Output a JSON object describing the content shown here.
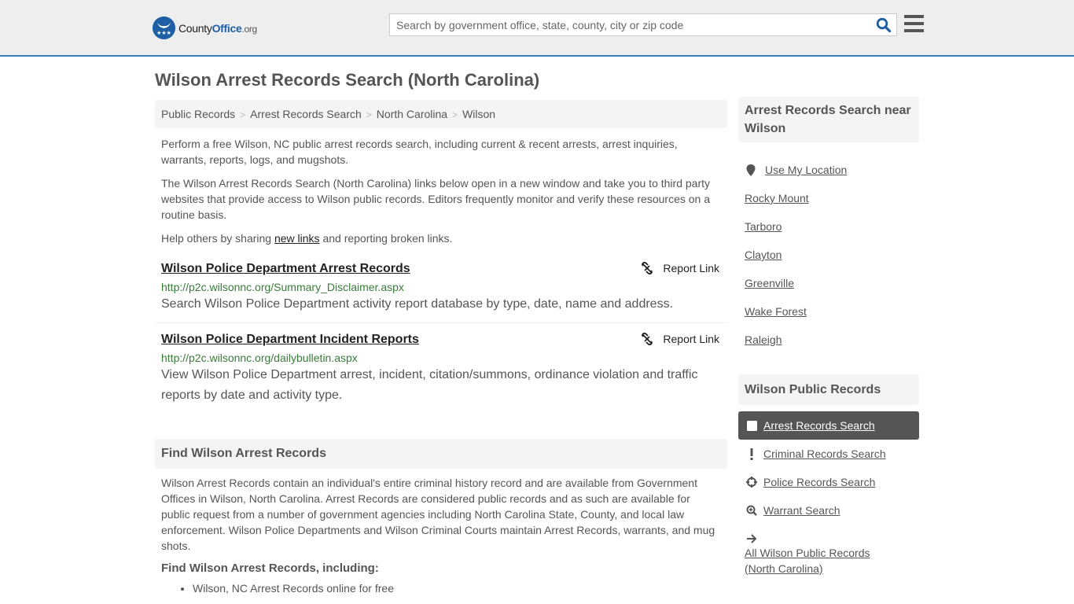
{
  "header": {
    "logo": {
      "name_part1": "County",
      "name_part2": "Office",
      "tld": ".org"
    },
    "search": {
      "placeholder": "Search by government office, state, county, city or zip code",
      "value": ""
    },
    "icons": {
      "search": "search-icon",
      "menu": "hamburger-menu-icon"
    }
  },
  "page": {
    "title": "Wilson Arrest Records Search (North Carolina)",
    "breadcrumb": [
      "Public Records",
      "Arrest Records Search",
      "North Carolina",
      "Wilson"
    ],
    "breadcrumb_separator": ">",
    "intro": {
      "p1": "Perform a free Wilson, NC public arrest records search, including current & recent arrests, arrest inquiries, warrants, reports, logs, and mugshots.",
      "p2": "The Wilson Arrest Records Search (North Carolina) links below open in a new window and take you to third party websites that provide access to Wilson public records. Editors frequently monitor and verify these resources on a routine basis.",
      "p3_before": "Help others by sharing ",
      "p3_link": "new links",
      "p3_after": " and reporting broken links."
    },
    "links": [
      {
        "title": "Wilson Police Department Arrest Records",
        "url": "http://p2c.wilsonnc.org/Summary_Disclaimer.aspx",
        "description": "Search Wilson Police Department activity report database by type, date, name and address.",
        "report_label": "Report Link"
      },
      {
        "title": "Wilson Police Department Incident Reports",
        "url": "http://p2c.wilsonnc.org/dailybulletin.aspx",
        "description": "View Wilson Police Department arrest, incident, citation/summons, ordinance violation and traffic reports by date and activity type.",
        "report_label": "Report Link"
      }
    ],
    "find_section": {
      "heading": "Find Wilson Arrest Records",
      "body": "Wilson Arrest Records contain an individual's entire criminal history record and are available from Government Offices in Wilson, North Carolina. Arrest Records are considered public records and as such are available for public request from a number of government agencies including North Carolina State, County, and local law enforcement. Wilson Police Departments and Wilson Criminal Courts maintain Arrest Records, warrants, and mug shots.",
      "subheading": "Find Wilson Arrest Records, including:",
      "bullets": [
        "Wilson, NC Arrest Records online for free"
      ]
    }
  },
  "sidebar": {
    "near": {
      "heading": "Arrest Records Search near Wilson",
      "use_location": "Use My Location",
      "cities": [
        "Rocky Mount",
        "Tarboro",
        "Clayton",
        "Greenville",
        "Wake Forest",
        "Raleigh"
      ]
    },
    "public_records": {
      "heading": "Wilson Public Records",
      "items": [
        {
          "label": "Arrest Records Search",
          "icon": "square-icon",
          "active": true
        },
        {
          "label": "Criminal Records Search",
          "icon": "exclamation-icon",
          "active": false
        },
        {
          "label": "Police Records Search",
          "icon": "crosshair-icon",
          "active": false
        },
        {
          "label": "Warrant Search",
          "icon": "zoom-in-icon",
          "active": false
        },
        {
          "label": "All Wilson Public Records (North Carolina)",
          "icon": "arrow-right-icon",
          "active": false
        }
      ]
    }
  },
  "colors": {
    "brand_blue": "#1d5ea5",
    "header_border": "#3a7cb0",
    "url_green": "#3a7a3a",
    "active_bg": "#555555"
  }
}
